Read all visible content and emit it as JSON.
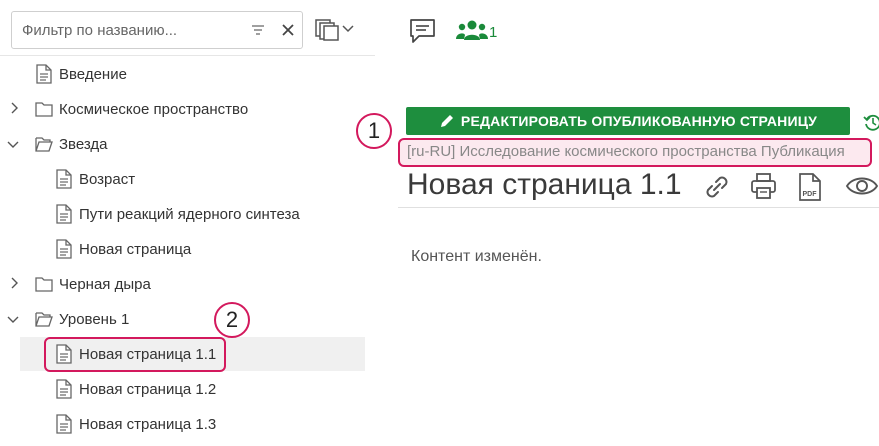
{
  "filter": {
    "placeholder": "Фильтр по названию..."
  },
  "tree": {
    "items": [
      {
        "label": "Введение",
        "type": "page",
        "expandable": false
      },
      {
        "label": "Космическое пространство",
        "type": "folder",
        "expandable": true,
        "expanded": false
      },
      {
        "label": "Звезда",
        "type": "folder",
        "expandable": true,
        "expanded": true
      },
      {
        "label": "Возраст",
        "type": "page",
        "expandable": false
      },
      {
        "label": "Пути реакций ядерного синтеза",
        "type": "page",
        "expandable": false
      },
      {
        "label": "Новая страница",
        "type": "page",
        "expandable": false
      },
      {
        "label": "Черная дыра",
        "type": "folder",
        "expandable": true,
        "expanded": false
      },
      {
        "label": "Уровень 1",
        "type": "folder",
        "expandable": true,
        "expanded": true
      },
      {
        "label": "Новая страница 1.1",
        "type": "page",
        "expandable": false,
        "selected": true
      },
      {
        "label": "Новая страница 1.2",
        "type": "page",
        "expandable": false
      },
      {
        "label": "Новая страница 1.3",
        "type": "page",
        "expandable": false
      }
    ]
  },
  "header": {
    "users_count": "1"
  },
  "page": {
    "edit_button_label": "РЕДАКТИРОВАТЬ ОПУБЛИКОВАННУЮ СТРАНИЦУ",
    "space_label": "[ru-RU] Исследование космического пространства Публикация",
    "title": "Новая страница 1.1",
    "content": "Контент изменён."
  },
  "callouts": {
    "first": "1",
    "second": "2"
  },
  "colors": {
    "accent_green": "#1e8e3e",
    "highlight": "#d3195d",
    "highlight_fill": "#fce9ef"
  }
}
